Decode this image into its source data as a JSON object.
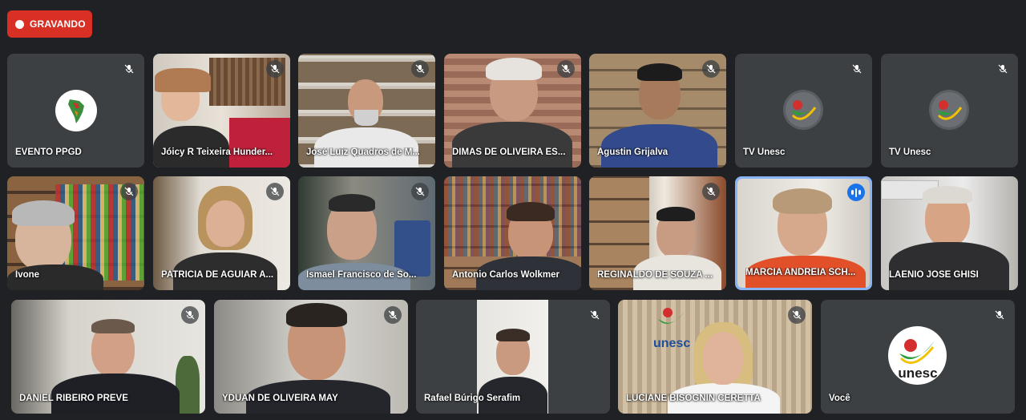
{
  "recording": {
    "label": "GRAVANDO"
  },
  "participants": [
    {
      "name": "EVENTO PPGD"
    },
    {
      "name": "Jóicy R Teixeira Hunder..."
    },
    {
      "name": "José Luiz Quadros de M..."
    },
    {
      "name": "DIMAS DE OLIVEIRA ES..."
    },
    {
      "name": "Agustin Grijalva"
    },
    {
      "name": "TV Unesc"
    },
    {
      "name": "TV Unesc"
    },
    {
      "name": "Ivone"
    },
    {
      "name": "PATRÍCIA DE AGUIAR A..."
    },
    {
      "name": "Ismael Francisco de So..."
    },
    {
      "name": "Antonio Carlos Wolkmer"
    },
    {
      "name": "REGINALDO DE SOUZA ..."
    },
    {
      "name": "MÁRCIA ANDRÉIA SCH..."
    },
    {
      "name": "LAÊNIO JOSÉ GHISI"
    },
    {
      "name": "DANIEL RIBEIRO PRÉVE"
    },
    {
      "name": "YDUAN DE OLIVEIRA MAY"
    },
    {
      "name": "Rafael Búrigo Serafim"
    },
    {
      "name": "LUCIANE BISOGNIN CERETTA"
    },
    {
      "name": "Você"
    }
  ],
  "logos": {
    "unesc_text": "unesc"
  },
  "colors": {
    "recording": "#d93025",
    "speaking": "#8ab4f8",
    "background": "#202124",
    "tile": "#3c4043"
  }
}
